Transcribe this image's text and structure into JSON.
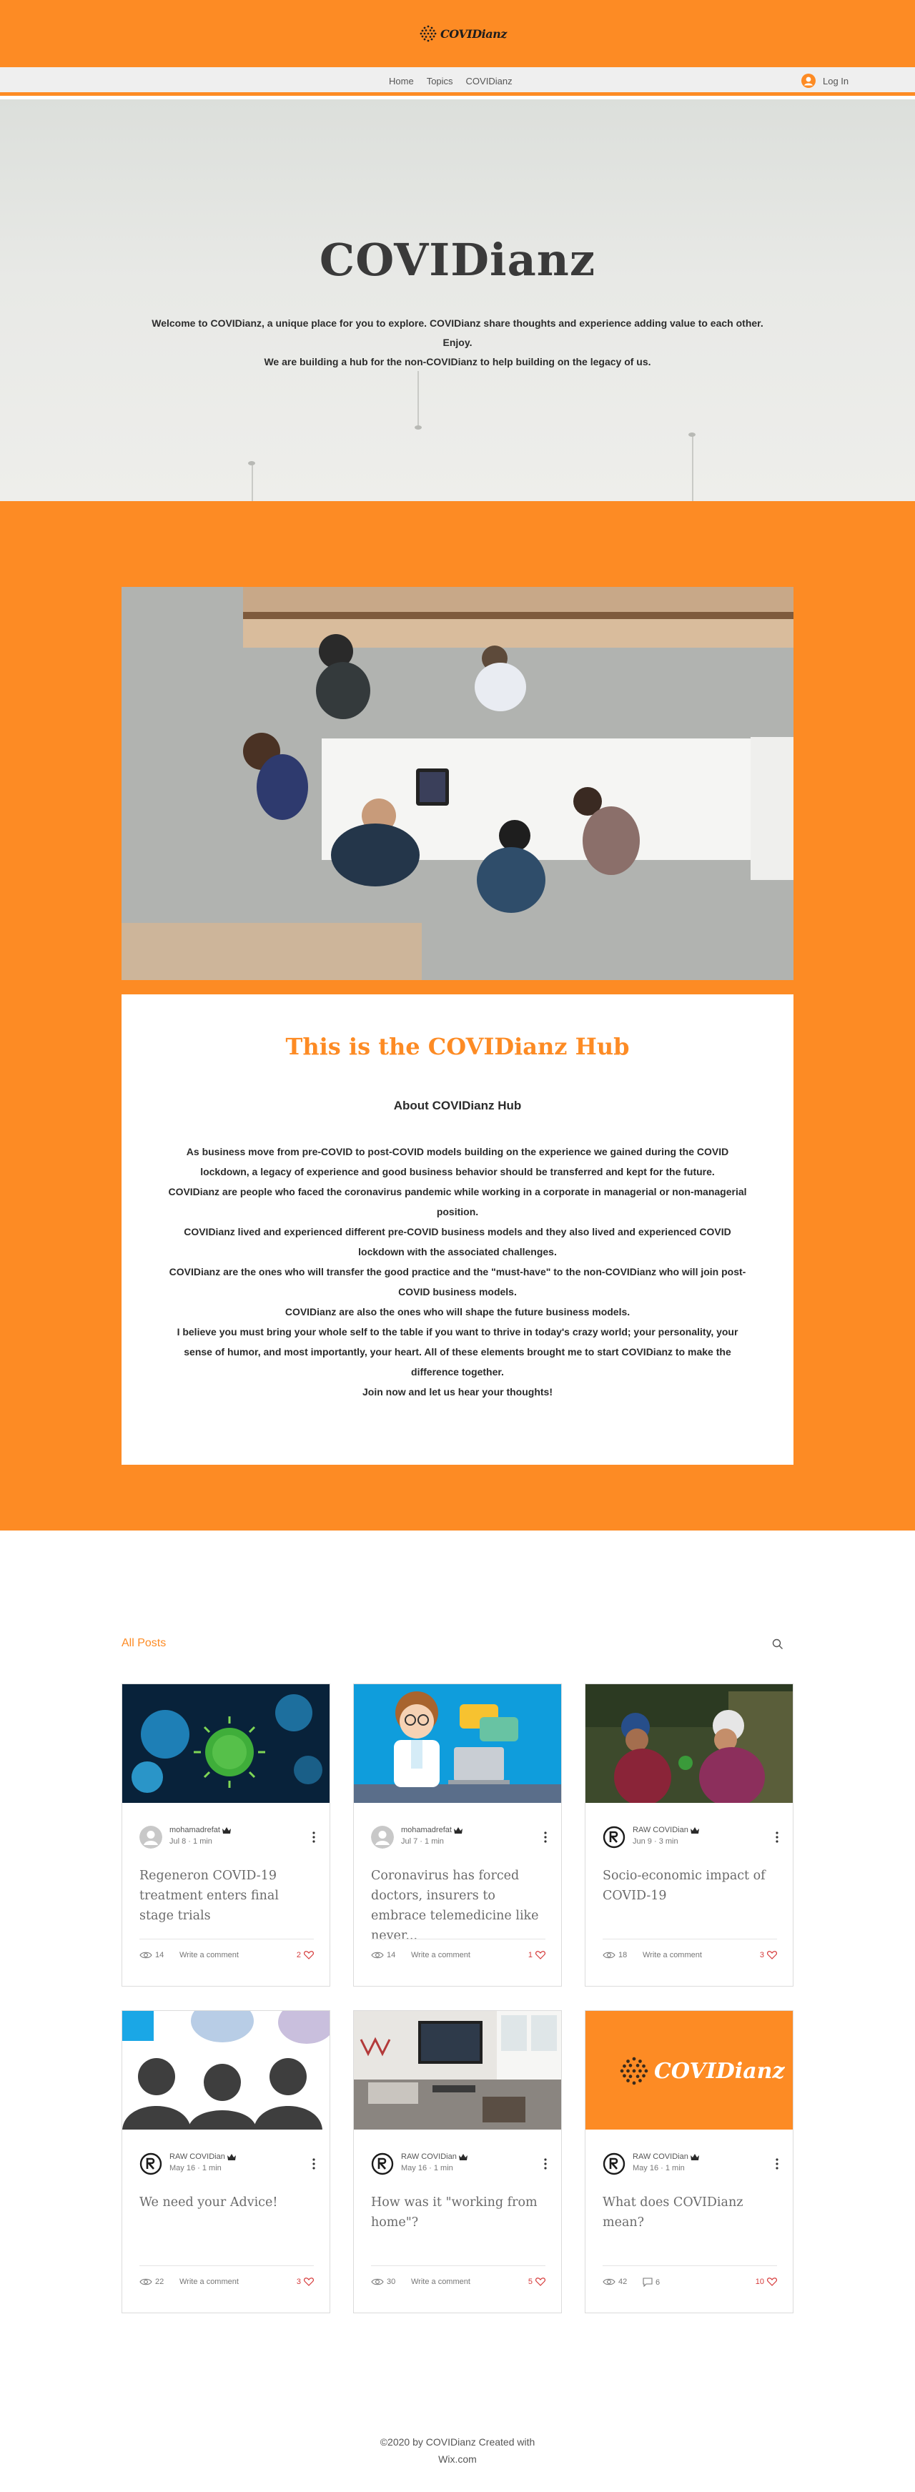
{
  "site": {
    "logo_text": "COVIDianz",
    "nav": [
      "Home",
      "Topics",
      "COVIDianz"
    ],
    "login": "Log In"
  },
  "hero": {
    "title": "COVIDianz",
    "line1": "Welcome to COVIDianz, a unique place for you to explore. COVIDianz share thoughts and experience adding value to each other. Enjoy.",
    "line2": "We are building a hub for the non-COVIDianz to help building on the legacy of us."
  },
  "hub": {
    "title": "This is the COVIDianz Hub",
    "about_title": "About COVIDianz Hub",
    "paragraphs": [
      "As business move from pre-COVID to post-COVID models building on the experience we gained during the COVID lockdown, a legacy of experience and good business behavior should be transferred and kept for the future.",
      "COVIDianz are people who faced the coronavirus pandemic while working in a corporate in managerial or non-managerial position.",
      "COVIDianz lived and experienced different pre-COVID  business models and they also lived and experienced COVID lockdown with the associated challenges.",
      "COVIDianz are the ones who will transfer the good practice and the \"must-have\" to the non-COVIDianz who will join post-COVID business models.",
      "COVIDianz are also the ones who will shape the future business models.",
      "I believe you must bring your whole self to the table if you want to thrive in today's crazy world; your personality, your sense of humor, and most importantly, your heart. All of these elements brought me to start COVIDianz to make the difference together.",
      "Join now and let us hear your thoughts!"
    ]
  },
  "posts": {
    "header": "All Posts",
    "write_comment": "Write a comment",
    "items": [
      {
        "author": "mohamadrefat",
        "date": "Jul 8",
        "read": "1 min",
        "title": "Regeneron COVID-19 treatment enters final stage trials",
        "views": "14",
        "comments": "",
        "likes": "2"
      },
      {
        "author": "mohamadrefat",
        "date": "Jul 7",
        "read": "1 min",
        "title": "Coronavirus has forced doctors, insurers to embrace telemedicine like never...",
        "views": "14",
        "comments": "",
        "likes": "1"
      },
      {
        "author": "RAW COVIDian",
        "date": "Jun 9",
        "read": "3 min",
        "title": "Socio-economic impact of COVID-19",
        "views": "18",
        "comments": "",
        "likes": "3"
      },
      {
        "author": "RAW COVIDian",
        "date": "May 16",
        "read": "1 min",
        "title": "We need your Advice!",
        "views": "22",
        "comments": "",
        "likes": "3"
      },
      {
        "author": "RAW COVIDian",
        "date": "May 16",
        "read": "1 min",
        "title": "How was it \"working from home\"?",
        "views": "30",
        "comments": "",
        "likes": "5"
      },
      {
        "author": "RAW COVIDian",
        "date": "May 16",
        "read": "1 min",
        "title": "What does COVIDianz mean?",
        "views": "42",
        "comments": "6",
        "likes": "10"
      }
    ]
  },
  "footer": {
    "line1": "©2020 by COVIDianz Created with",
    "line2": "Wix.com"
  },
  "colors": {
    "brand_orange": "#fd8b24",
    "like_red": "#d63a3a"
  }
}
